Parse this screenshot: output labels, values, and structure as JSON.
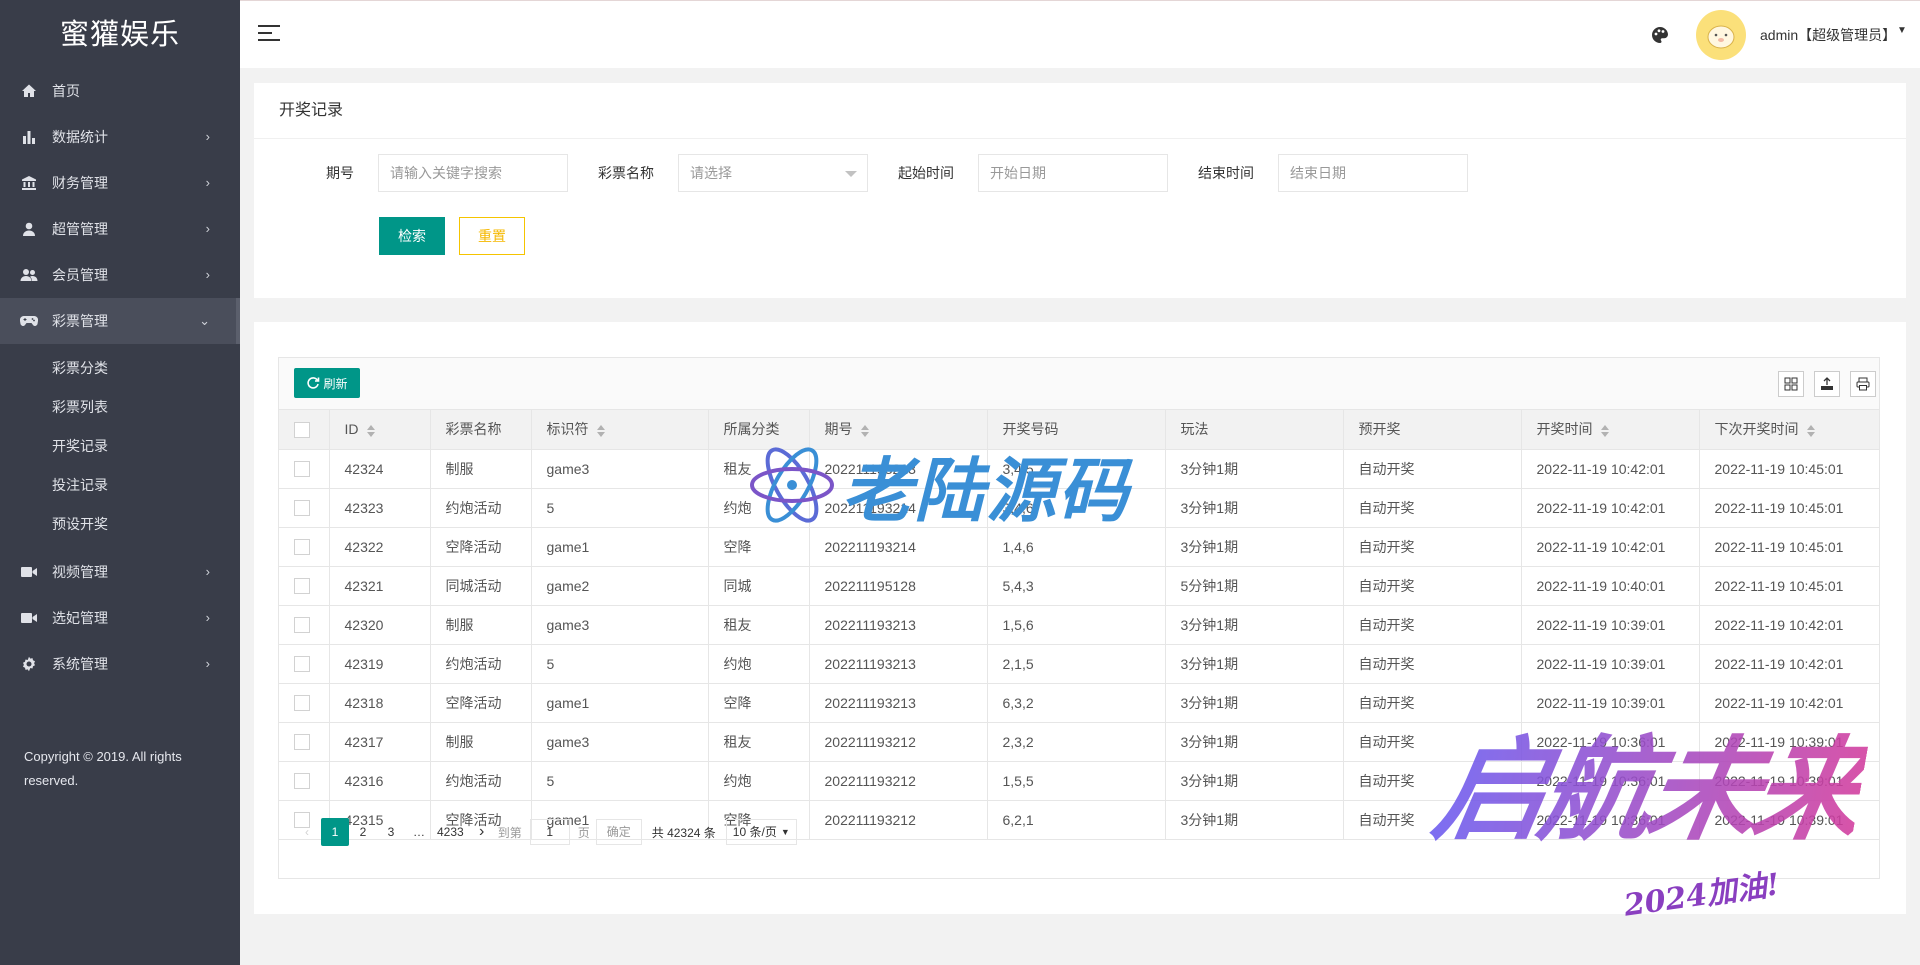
{
  "brand": {
    "name": "蜜獾娱乐"
  },
  "sidebar": {
    "items": [
      {
        "label": "首页",
        "icon": "home-icon",
        "has_children": false
      },
      {
        "label": "数据统计",
        "icon": "bar-chart-icon",
        "has_children": true
      },
      {
        "label": "财务管理",
        "icon": "bank-icon",
        "has_children": true
      },
      {
        "label": "超管管理",
        "icon": "user-icon",
        "has_children": true
      },
      {
        "label": "会员管理",
        "icon": "users-icon",
        "has_children": true
      },
      {
        "label": "彩票管理",
        "icon": "gamepad-icon",
        "has_children": true,
        "expanded": true
      }
    ],
    "sub_items": [
      "彩票分类",
      "彩票列表",
      "开奖记录",
      "投注记录",
      "预设开奖"
    ],
    "items_after": [
      {
        "label": "视频管理",
        "icon": "video-icon"
      },
      {
        "label": "选妃管理",
        "icon": "camera-icon"
      },
      {
        "label": "系统管理",
        "icon": "gear-icon"
      }
    ],
    "copyright": "Copyright © 2019. All rights reserved."
  },
  "header": {
    "user": "admin【超级管理员】"
  },
  "search": {
    "title": "开奖记录",
    "period_label": "期号",
    "period_placeholder": "请输入关键字搜索",
    "lottery_label": "彩票名称",
    "lottery_placeholder": "请选择",
    "start_label": "起始时间",
    "start_placeholder": "开始日期",
    "end_label": "结束时间",
    "end_placeholder": "结束日期",
    "search_button": "检索",
    "reset_button": "重置"
  },
  "table": {
    "refresh_label": "刷新",
    "columns": [
      "ID",
      "彩票名称",
      "标识符",
      "所属分类",
      "期号",
      "开奖号码",
      "玩法",
      "预开奖",
      "开奖时间",
      "下次开奖时间"
    ],
    "rows": [
      [
        "42324",
        "制服",
        "game3",
        "租友",
        "202211193213",
        "3,4,5",
        "3分钟1期",
        "自动开奖",
        "2022-11-19 10:42:01",
        "2022-11-19 10:45:01"
      ],
      [
        "42323",
        "约炮活动",
        "5",
        "约炮",
        "202211193214",
        "3,4,6",
        "3分钟1期",
        "自动开奖",
        "2022-11-19 10:42:01",
        "2022-11-19 10:45:01"
      ],
      [
        "42322",
        "空降活动",
        "game1",
        "空降",
        "202211193214",
        "1,4,6",
        "3分钟1期",
        "自动开奖",
        "2022-11-19 10:42:01",
        "2022-11-19 10:45:01"
      ],
      [
        "42321",
        "同城活动",
        "game2",
        "同城",
        "202211195128",
        "5,4,3",
        "5分钟1期",
        "自动开奖",
        "2022-11-19 10:40:01",
        "2022-11-19 10:45:01"
      ],
      [
        "42320",
        "制服",
        "game3",
        "租友",
        "202211193213",
        "1,5,6",
        "3分钟1期",
        "自动开奖",
        "2022-11-19 10:39:01",
        "2022-11-19 10:42:01"
      ],
      [
        "42319",
        "约炮活动",
        "5",
        "约炮",
        "202211193213",
        "2,1,5",
        "3分钟1期",
        "自动开奖",
        "2022-11-19 10:39:01",
        "2022-11-19 10:42:01"
      ],
      [
        "42318",
        "空降活动",
        "game1",
        "空降",
        "202211193213",
        "6,3,2",
        "3分钟1期",
        "自动开奖",
        "2022-11-19 10:39:01",
        "2022-11-19 10:42:01"
      ],
      [
        "42317",
        "制服",
        "game3",
        "租友",
        "202211193212",
        "2,3,2",
        "3分钟1期",
        "自动开奖",
        "2022-11-19 10:36:01",
        "2022-11-19 10:39:01"
      ],
      [
        "42316",
        "约炮活动",
        "5",
        "约炮",
        "202211193212",
        "1,5,5",
        "3分钟1期",
        "自动开奖",
        "2022-11-19 10:36:01",
        "2022-11-19 10:39:01"
      ],
      [
        "42315",
        "空降活动",
        "game1",
        "空降",
        "202211193212",
        "6,2,1",
        "3分钟1期",
        "自动开奖",
        "2022-11-19 10:36:01",
        "2022-11-19 10:39:01"
      ]
    ]
  },
  "pager": {
    "pages": [
      "1",
      "2",
      "3",
      "…",
      "4233"
    ],
    "current": "1",
    "goto_label": "到第",
    "goto_value": "1",
    "page_unit": "页",
    "confirm": "确定",
    "total": "共 42324 条",
    "page_size": "10 条/页"
  },
  "watermarks": {
    "brand": "老陆源码",
    "slogan": "启航未来",
    "slogan_sub": "2024加油!"
  },
  "colors": {
    "sidebar": "#393d49",
    "accent": "#009688",
    "reset": "#f5b800"
  }
}
